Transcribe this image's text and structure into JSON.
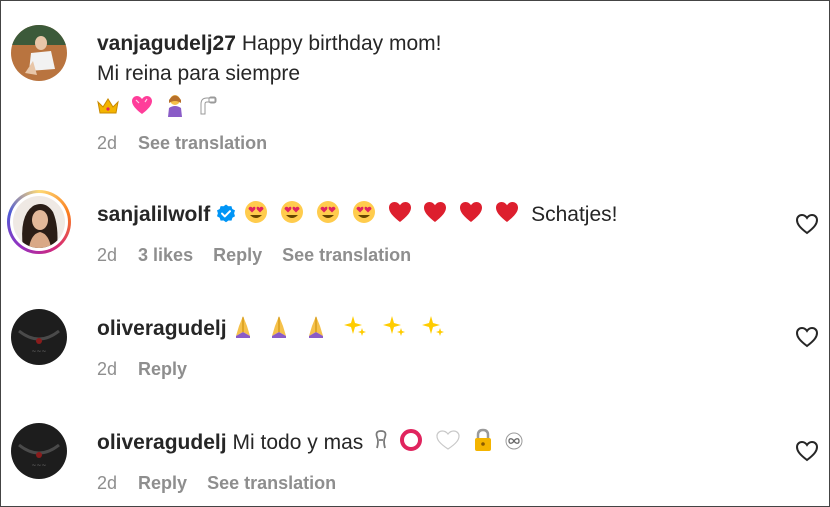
{
  "comments": [
    {
      "username": "vanjagudelj27",
      "text_line1": "Happy birthday mom!",
      "text_line2": "Mi reina para siempre",
      "emojis": [
        "crown-emoji",
        "pink-heart-emoji",
        "woman-gesturing-emoji",
        "nail-emoji"
      ],
      "time": "2d",
      "actions": [
        "See translation"
      ]
    },
    {
      "username": "sanjalilwolf",
      "verified": true,
      "emojis": [
        "heart-eyes-emoji",
        "heart-eyes-emoji",
        "heart-eyes-emoji",
        "heart-eyes-emoji",
        "red-heart-emoji",
        "red-heart-emoji",
        "red-heart-emoji",
        "red-heart-emoji"
      ],
      "text": "Schatjes!",
      "time": "2d",
      "likes": "3 likes",
      "actions": [
        "Reply",
        "See translation"
      ]
    },
    {
      "username": "oliveragudelj",
      "emojis": [
        "praying-hands-emoji",
        "praying-hands-emoji",
        "praying-hands-emoji",
        "sparkles-emoji",
        "sparkles-emoji",
        "sparkles-emoji"
      ],
      "time": "2d",
      "actions": [
        "Reply"
      ]
    },
    {
      "username": "oliveragudelj",
      "text": "Mi todo y mas",
      "emojis": [
        "ribbon-emoji",
        "red-circle-emoji",
        "white-heart-emoji",
        "lock-emoji",
        "infinity-emoji"
      ],
      "time": "2d",
      "actions": [
        "Reply",
        "See translation"
      ]
    }
  ],
  "colors": {
    "text": "#262626",
    "meta": "#8e8e8e",
    "verified": "#0095f6",
    "heart_red": "#ed4956",
    "heart_eyes_face": "#ffcc4d"
  }
}
